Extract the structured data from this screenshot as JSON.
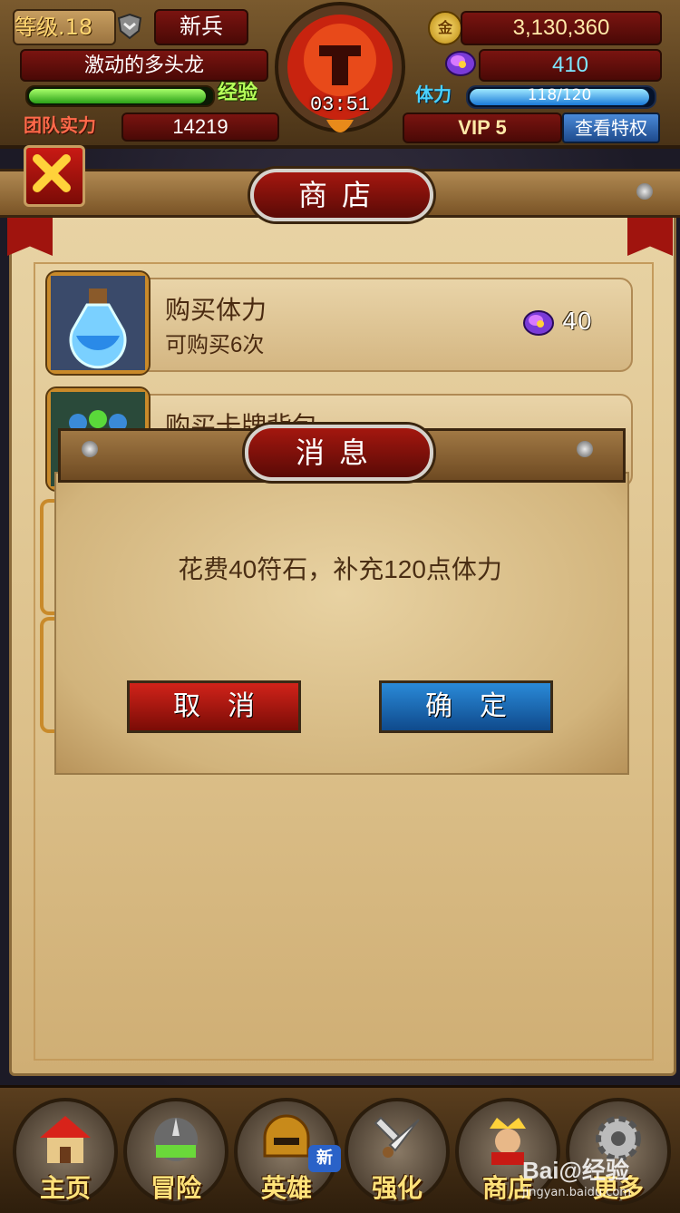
{
  "hud": {
    "level": "等级.18",
    "rank": "新兵",
    "player_name": "激动的多头龙",
    "exp_label": "经验",
    "exp_fraction": 0.97,
    "power_label": "团队实力",
    "power_value": "14219",
    "timer": "03:51",
    "gold_icon_label": "金",
    "gold": "3,130,360",
    "gems": "410",
    "stamina_label": "体力",
    "stamina": "118/120",
    "stamina_fraction": 0.98,
    "vip": "VIP  5",
    "privilege_button": "查看特权"
  },
  "shop": {
    "title": "商店",
    "items": [
      {
        "name": "购买体力",
        "sub": "可购买6次",
        "price": "40",
        "icon": "potion-icon"
      },
      {
        "name": "购买卡牌背包",
        "icon": "card-bag-icon"
      }
    ]
  },
  "dialog": {
    "title": "消息",
    "message": "花费40符石，补充120点体力",
    "cancel": "取消",
    "confirm": "确定"
  },
  "nav": {
    "items": [
      {
        "label": "主页",
        "icon": "home-icon"
      },
      {
        "label": "冒险",
        "icon": "adventure-icon"
      },
      {
        "label": "英雄",
        "icon": "hero-icon"
      },
      {
        "label": "强化",
        "icon": "enhance-icon"
      },
      {
        "label": "商店",
        "icon": "shop-icon"
      },
      {
        "label": "更多",
        "icon": "more-icon"
      }
    ],
    "new_badge": "新"
  },
  "watermark": {
    "brand": "Bai@经验",
    "url": "jingyan.baidu.com"
  },
  "colors": {
    "accent_red": "#a4170f",
    "accent_blue": "#2a8ad8",
    "gold": "#ffe9a8",
    "parchment": "#e8d3a4"
  }
}
